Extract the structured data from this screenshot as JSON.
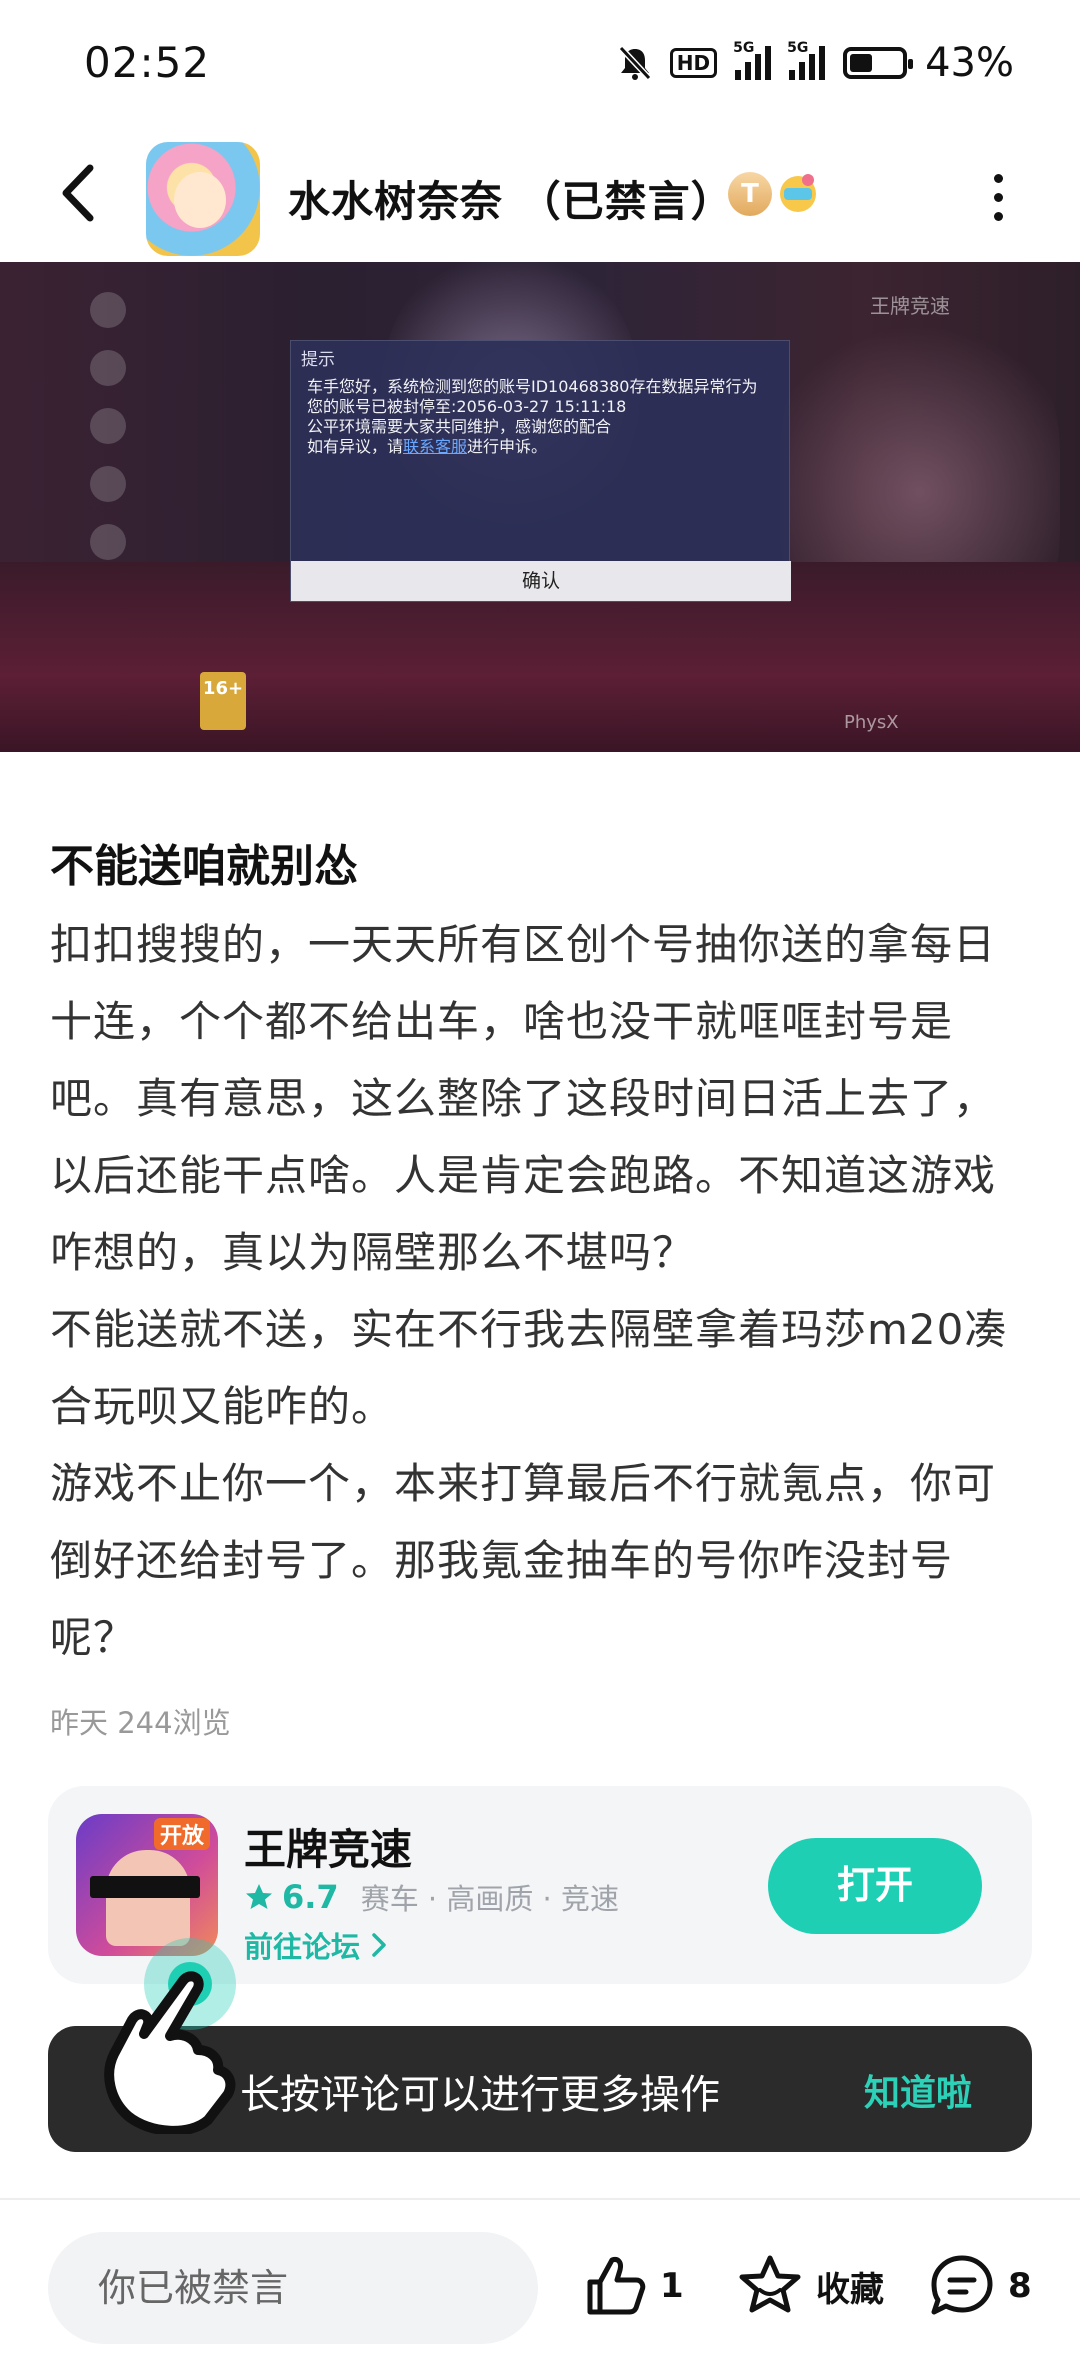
{
  "status_bar": {
    "time": "02:52",
    "hd_label": "HD",
    "net1": "5G",
    "net2": "5G",
    "battery_text": "43%",
    "battery_level": 0.43
  },
  "header": {
    "title": "水水树奈奈 （已禁言）",
    "level_badge": "T"
  },
  "screenshot": {
    "dialog_title": "提示",
    "line1": "车手您好，系统检测到您的账号ID10468380存在数据异常行为",
    "line2": "您的账号已被封停至:2056-03-27 15:11:18",
    "line3": "公平环境需要大家共同维护，感谢您的配合",
    "line4_pre": "如有异议，请",
    "line4_link": "联系客服",
    "line4_post": "进行申诉。",
    "ok_label": "确认",
    "logo_text": "王牌竞速",
    "age_badge": "16+",
    "physx": "PhysX"
  },
  "post": {
    "title": "不能送咱就别怂",
    "paragraphs": [
      "扣扣搜搜的，一天天所有区创个号抽你送的拿每日十连，个个都不给出车，啥也没干就哐哐封号是吧。真有意思，这么整除了这段时间日活上去了，以后还能干点啥。人是肯定会跑路。不知道这游戏咋想的，真以为隔壁那么不堪吗？",
      "不能送就不送，实在不行我去隔壁拿着玛莎m20凑合玩呗又能咋的。",
      "游戏不止你一个，本来打算最后不行就氪点，你可倒好还给封号了。那我氪金抽车的号你咋没封号呢？"
    ],
    "meta": "昨天  244浏览"
  },
  "game_card": {
    "icon_tag": "开放",
    "name": "王牌竞速",
    "rating": "6.7",
    "tags": "赛车 · 高画质 · 竞速",
    "forum_link": "前往论坛",
    "open_label": "打开"
  },
  "hint": {
    "text": "长按评论可以进行更多操作",
    "dismiss": "知道啦"
  },
  "bottom_bar": {
    "input_placeholder": "你已被禁言",
    "like_count": "1",
    "favorite_label": "收藏",
    "comment_count": "8"
  },
  "colors": {
    "accent": "#1fcfb4",
    "accent_text": "#1fb8a4",
    "hint_bg": "#2b2b2b"
  }
}
